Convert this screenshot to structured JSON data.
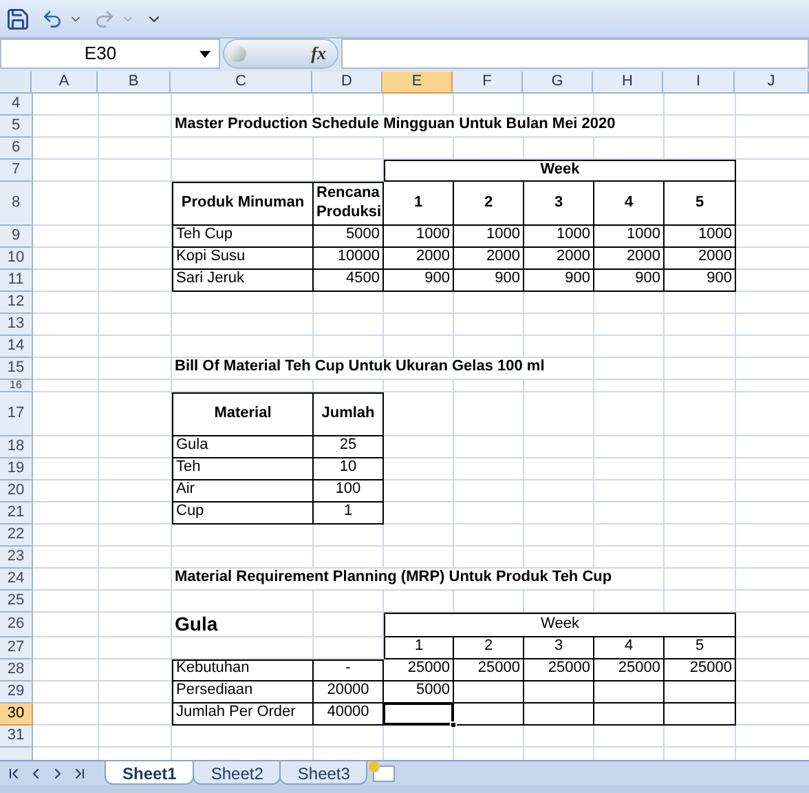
{
  "name_box": {
    "value": "E30"
  },
  "formula_bar": {
    "function_label": "fx"
  },
  "columns": [
    {
      "label": "A",
      "selected": false
    },
    {
      "label": "B",
      "selected": false
    },
    {
      "label": "C",
      "selected": false
    },
    {
      "label": "D",
      "selected": false
    },
    {
      "label": "E",
      "selected": true
    },
    {
      "label": "F",
      "selected": false
    },
    {
      "label": "G",
      "selected": false
    },
    {
      "label": "H",
      "selected": false
    },
    {
      "label": "I",
      "selected": false
    },
    {
      "label": "J",
      "selected": false
    }
  ],
  "rows": [
    {
      "number": "4",
      "selected": false
    },
    {
      "number": "5",
      "selected": false,
      "cells": [
        null,
        null,
        {
          "text": "Master Production Schedule Mingguan Untuk Bulan Mei 2020",
          "kind": "title"
        }
      ]
    },
    {
      "number": "6",
      "selected": false
    },
    {
      "number": "7",
      "selected": false,
      "cells": [
        null,
        null,
        null,
        null,
        {
          "text": "Week",
          "kind": "merged-header"
        }
      ]
    },
    {
      "number": "8",
      "selected": false,
      "cells": [
        null,
        null,
        {
          "text": "Produk Minuman",
          "kind": "header"
        },
        {
          "text": "Rencana Produksi",
          "kind": "header-wrap"
        },
        {
          "text": "1",
          "kind": "header"
        },
        {
          "text": "2",
          "kind": "header"
        },
        {
          "text": "3",
          "kind": "header"
        },
        {
          "text": "4",
          "kind": "header"
        },
        {
          "text": "5",
          "kind": "header"
        }
      ]
    },
    {
      "number": "9",
      "selected": false,
      "cells": [
        null,
        null,
        {
          "text": "Teh Cup",
          "kind": "text"
        },
        {
          "text": "5000",
          "kind": "number"
        },
        {
          "text": "1000",
          "kind": "number"
        },
        {
          "text": "1000",
          "kind": "number"
        },
        {
          "text": "1000",
          "kind": "number"
        },
        {
          "text": "1000",
          "kind": "number"
        },
        {
          "text": "1000",
          "kind": "number"
        }
      ]
    },
    {
      "number": "10",
      "selected": false,
      "cells": [
        null,
        null,
        {
          "text": "Kopi Susu",
          "kind": "text"
        },
        {
          "text": "10000",
          "kind": "number"
        },
        {
          "text": "2000",
          "kind": "number"
        },
        {
          "text": "2000",
          "kind": "number"
        },
        {
          "text": "2000",
          "kind": "number"
        },
        {
          "text": "2000",
          "kind": "number"
        },
        {
          "text": "2000",
          "kind": "number"
        }
      ]
    },
    {
      "number": "11",
      "selected": false,
      "cells": [
        null,
        null,
        {
          "text": "Sari Jeruk",
          "kind": "text"
        },
        {
          "text": "4500",
          "kind": "number"
        },
        {
          "text": "900",
          "kind": "number"
        },
        {
          "text": "900",
          "kind": "number"
        },
        {
          "text": "900",
          "kind": "number"
        },
        {
          "text": "900",
          "kind": "number"
        },
        {
          "text": "900",
          "kind": "number"
        }
      ]
    },
    {
      "number": "12",
      "selected": false
    },
    {
      "number": "13",
      "selected": false
    },
    {
      "number": "14",
      "selected": false
    },
    {
      "number": "15",
      "selected": false,
      "cells": [
        null,
        null,
        {
          "text": "Bill Of Material Teh Cup Untuk Ukuran Gelas 100 ml",
          "kind": "title"
        }
      ]
    },
    {
      "number": "16",
      "selected": false
    },
    {
      "number": "17",
      "selected": false,
      "cells": [
        null,
        null,
        {
          "text": "Material",
          "kind": "header"
        },
        {
          "text": "Jumlah",
          "kind": "header"
        }
      ]
    },
    {
      "number": "18",
      "selected": false,
      "cells": [
        null,
        null,
        {
          "text": "Gula",
          "kind": "text"
        },
        {
          "text": "25",
          "kind": "center"
        }
      ]
    },
    {
      "number": "19",
      "selected": false,
      "cells": [
        null,
        null,
        {
          "text": "Teh",
          "kind": "text"
        },
        {
          "text": "10",
          "kind": "center"
        }
      ]
    },
    {
      "number": "20",
      "selected": false,
      "cells": [
        null,
        null,
        {
          "text": "Air",
          "kind": "text"
        },
        {
          "text": "100",
          "kind": "center"
        }
      ]
    },
    {
      "number": "21",
      "selected": false,
      "cells": [
        null,
        null,
        {
          "text": "Cup",
          "kind": "text"
        },
        {
          "text": "1",
          "kind": "center"
        }
      ]
    },
    {
      "number": "22",
      "selected": false
    },
    {
      "number": "23",
      "selected": false
    },
    {
      "number": "24",
      "selected": false,
      "cells": [
        null,
        null,
        {
          "text": "Material Requirement Planning (MRP) Untuk Produk Teh Cup",
          "kind": "title"
        }
      ]
    },
    {
      "number": "25",
      "selected": false
    },
    {
      "number": "26",
      "selected": false,
      "cells": [
        null,
        null,
        {
          "text": "Gula",
          "kind": "heading"
        },
        null,
        {
          "text": "Week",
          "kind": "merged"
        }
      ]
    },
    {
      "number": "27",
      "selected": false,
      "cells": [
        null,
        null,
        null,
        null,
        {
          "text": "1",
          "kind": "center"
        },
        {
          "text": "2",
          "kind": "center"
        },
        {
          "text": "3",
          "kind": "center"
        },
        {
          "text": "4",
          "kind": "center"
        },
        {
          "text": "5",
          "kind": "center"
        }
      ]
    },
    {
      "number": "28",
      "selected": false,
      "cells": [
        null,
        null,
        {
          "text": "Kebutuhan",
          "kind": "text"
        },
        {
          "text": "-",
          "kind": "center"
        },
        {
          "text": "25000",
          "kind": "number"
        },
        {
          "text": "25000",
          "kind": "number"
        },
        {
          "text": "25000",
          "kind": "number"
        },
        {
          "text": "25000",
          "kind": "number"
        },
        {
          "text": "25000",
          "kind": "number"
        }
      ]
    },
    {
      "number": "29",
      "selected": false,
      "cells": [
        null,
        null,
        {
          "text": "Persediaan",
          "kind": "text"
        },
        {
          "text": "20000",
          "kind": "center"
        },
        {
          "text": "5000",
          "kind": "number"
        }
      ]
    },
    {
      "number": "30",
      "selected": true,
      "cells": [
        null,
        null,
        {
          "text": "Jumlah Per Order",
          "kind": "text"
        },
        {
          "text": "40000",
          "kind": "center"
        }
      ]
    },
    {
      "number": "31",
      "selected": false
    }
  ],
  "sheet_tabs": [
    {
      "label": "Sheet1",
      "selected": true
    },
    {
      "label": "Sheet2",
      "selected": false
    },
    {
      "label": "Sheet3",
      "selected": false
    }
  ]
}
